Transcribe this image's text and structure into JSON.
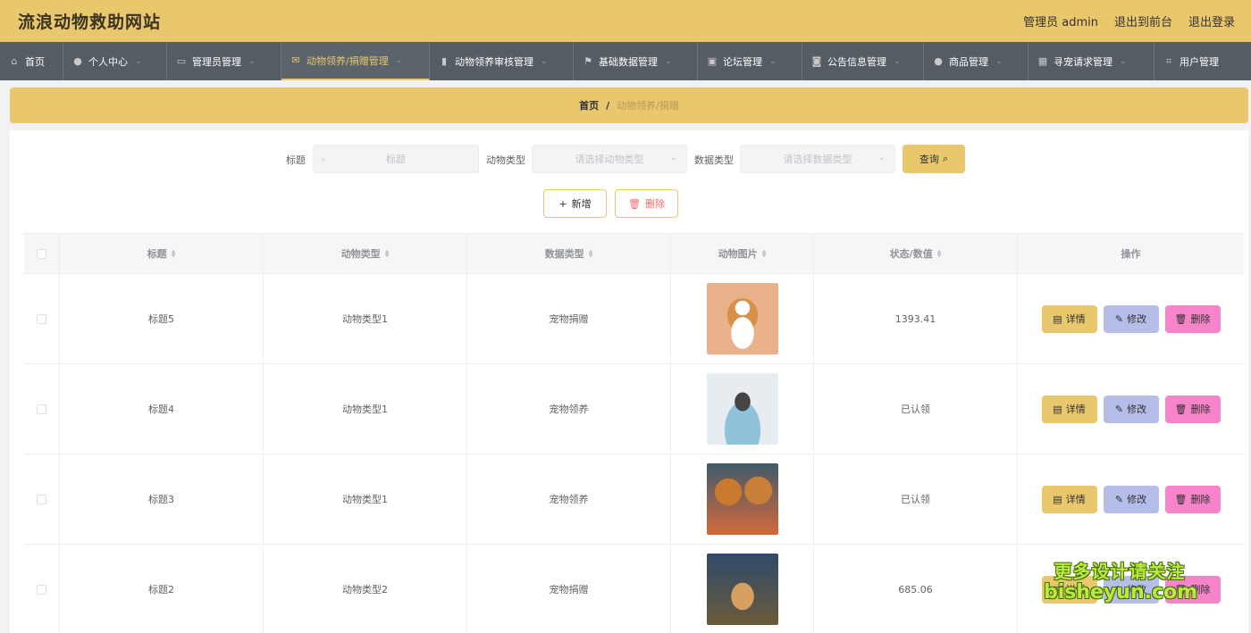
{
  "header": {
    "site_title": "流浪动物救助网站",
    "links": [
      "管理员 admin",
      "退出到前台",
      "退出登录"
    ]
  },
  "nav": {
    "items": [
      {
        "label": "首页",
        "icon": "home-icon",
        "width": 71
      },
      {
        "label": "个人中心",
        "icon": "user-icon",
        "width": 116
      },
      {
        "label": "管理员管理",
        "icon": "id-card-icon",
        "width": 128
      },
      {
        "label": "动物领养/捐赠管理",
        "icon": "mail-icon",
        "width": 166,
        "active": true
      },
      {
        "label": "动物领养审核管理",
        "icon": "bar-chart-icon",
        "width": 161
      },
      {
        "label": "基础数据管理",
        "icon": "flag-icon",
        "width": 139
      },
      {
        "label": "论坛管理",
        "icon": "clipboard-icon",
        "width": 117
      },
      {
        "label": "公告信息管理",
        "icon": "camera-icon",
        "width": 136
      },
      {
        "label": "商品管理",
        "icon": "pin-icon",
        "width": 117
      },
      {
        "label": "寻宠请求管理",
        "icon": "grid-icon",
        "width": 141
      },
      {
        "label": "用户管理",
        "icon": "crop-icon",
        "width": 108
      }
    ]
  },
  "breadcrumb": {
    "home": "首页",
    "separator": "/",
    "current": "动物领养/捐赠"
  },
  "search": {
    "title_label": "标题",
    "title_placeholder": "标题",
    "animal_type_label": "动物类型",
    "animal_type_placeholder": "请选择动物类型",
    "data_type_label": "数据类型",
    "data_type_placeholder": "请选择数据类型",
    "query_button": "查询"
  },
  "actions": {
    "add": "新增",
    "delete": "删除"
  },
  "table": {
    "headers": [
      "标题",
      "动物类型",
      "数据类型",
      "动物图片",
      "状态/数值",
      "操作"
    ],
    "rows": [
      {
        "title": "标题5",
        "animal_type": "动物类型1",
        "data_type": "宠物捐赠",
        "photo": "corgi-dog-photo",
        "status": "1393.41"
      },
      {
        "title": "标题4",
        "animal_type": "动物类型1",
        "data_type": "宠物领养",
        "photo": "schnauzer-dog-photo",
        "status": "已认领"
      },
      {
        "title": "标题3",
        "animal_type": "动物类型1",
        "data_type": "宠物领养",
        "photo": "pomeranian-dogs-photo",
        "status": "已认领"
      },
      {
        "title": "标题2",
        "animal_type": "动物类型2",
        "data_type": "宠物捐赠",
        "photo": "shiba-dog-photo",
        "status": "685.06"
      }
    ],
    "row_actions": {
      "detail": "详情",
      "edit": "修改",
      "delete": "删除"
    }
  },
  "watermark": {
    "line1": "更多设计请关注",
    "line2": "bisheyun.com"
  }
}
